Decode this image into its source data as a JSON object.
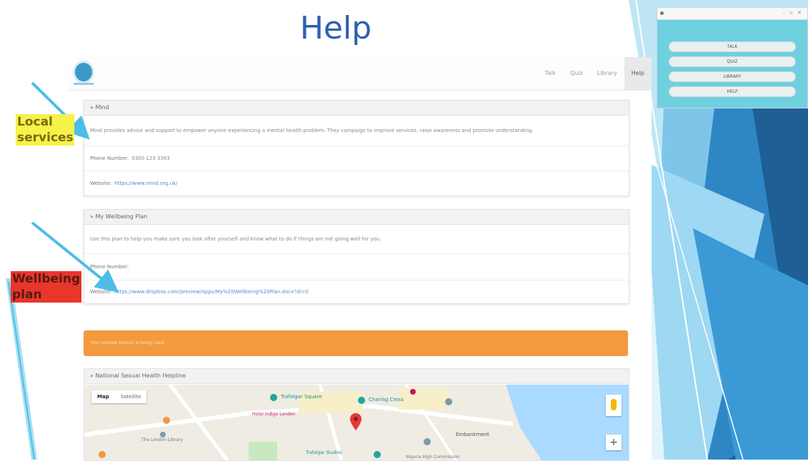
{
  "slide": {
    "title": "Help"
  },
  "mini_window": {
    "buttons": [
      "TALK",
      "QUIZ",
      "LIBRARY",
      "HELP"
    ]
  },
  "app": {
    "nav": [
      "Talk",
      "Quiz",
      "Library",
      "Help"
    ],
    "active_nav": "Help",
    "panels": [
      {
        "title": "» Mind",
        "description": "Mind provides advice and support to empower anyone experiencing a mental health problem. They campaign to improve services, raise awareness and promote understanding.",
        "phone_label": "Phone Number:",
        "phone": "0300 123 3393",
        "website_label": "Website:",
        "website": "https://www.mind.org.uk/"
      },
      {
        "title": "» My Wellbeing Plan",
        "description": "Use this plan to help you make sure you look after yourself and know what to do if things are not going well for you.",
        "phone_label": "Phone Number:",
        "phone": "",
        "website_label": "Website:",
        "website": "https://www.dropbox.com/preview/Apps/My%20Wellbeing%20Plan.docx?dl=0"
      }
    ],
    "alert": "Your nearest council is being used.",
    "map_panel": {
      "title": "» National Sexual Health Helpline",
      "map_type_buttons": [
        "Map",
        "Satellite"
      ],
      "zoom_in": "+",
      "places": [
        "Trafalgar Square",
        "Charing Cross",
        "Embankment",
        "Hotel Indigo London",
        "The London Library",
        "Trafalgar Studios",
        "Nigeria High Commission"
      ]
    }
  },
  "annotations": {
    "local_services": "Local services",
    "wellbeing_plan": "Wellbeing plan"
  },
  "colors": {
    "title": "#2f5fae",
    "alert": "#f39a3e",
    "arrow": "#4dbde6",
    "local_highlight": "#f6f24a",
    "wellbeing_highlight": "#e8362b"
  }
}
